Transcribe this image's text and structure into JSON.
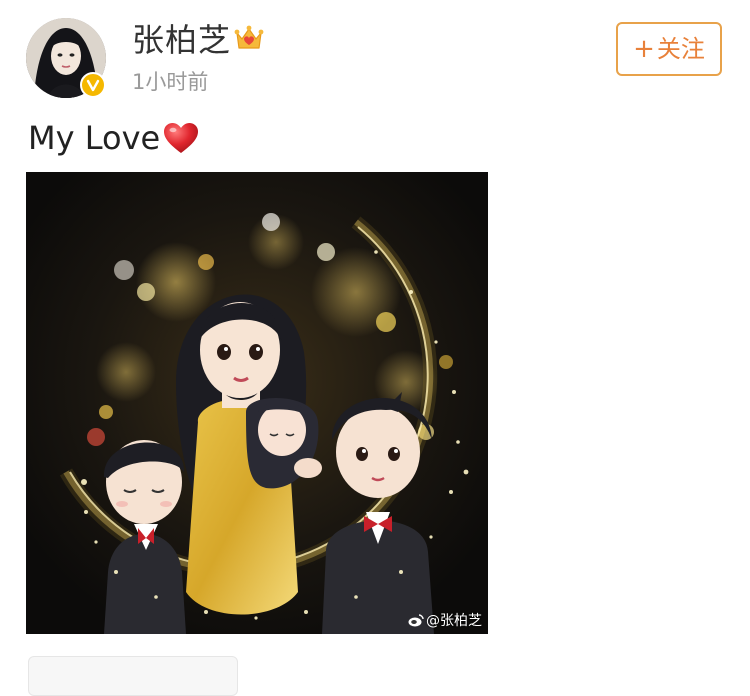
{
  "post": {
    "author": {
      "name": "张柏芝",
      "time": "1小时前",
      "verified": true,
      "vip_crown": true
    },
    "follow_button": {
      "plus": "+",
      "label": "关注"
    },
    "text": "My Love",
    "text_emoji": "heart-icon",
    "image": {
      "watermark": "@张柏芝",
      "description_icon": "weibo-icon"
    }
  },
  "colors": {
    "accent_orange": "#e8813a",
    "follow_border": "#e8a24a",
    "verified_gold": "#f5b800",
    "timestamp_gray": "#9a9a9a",
    "heart_red": "#e0262e"
  }
}
